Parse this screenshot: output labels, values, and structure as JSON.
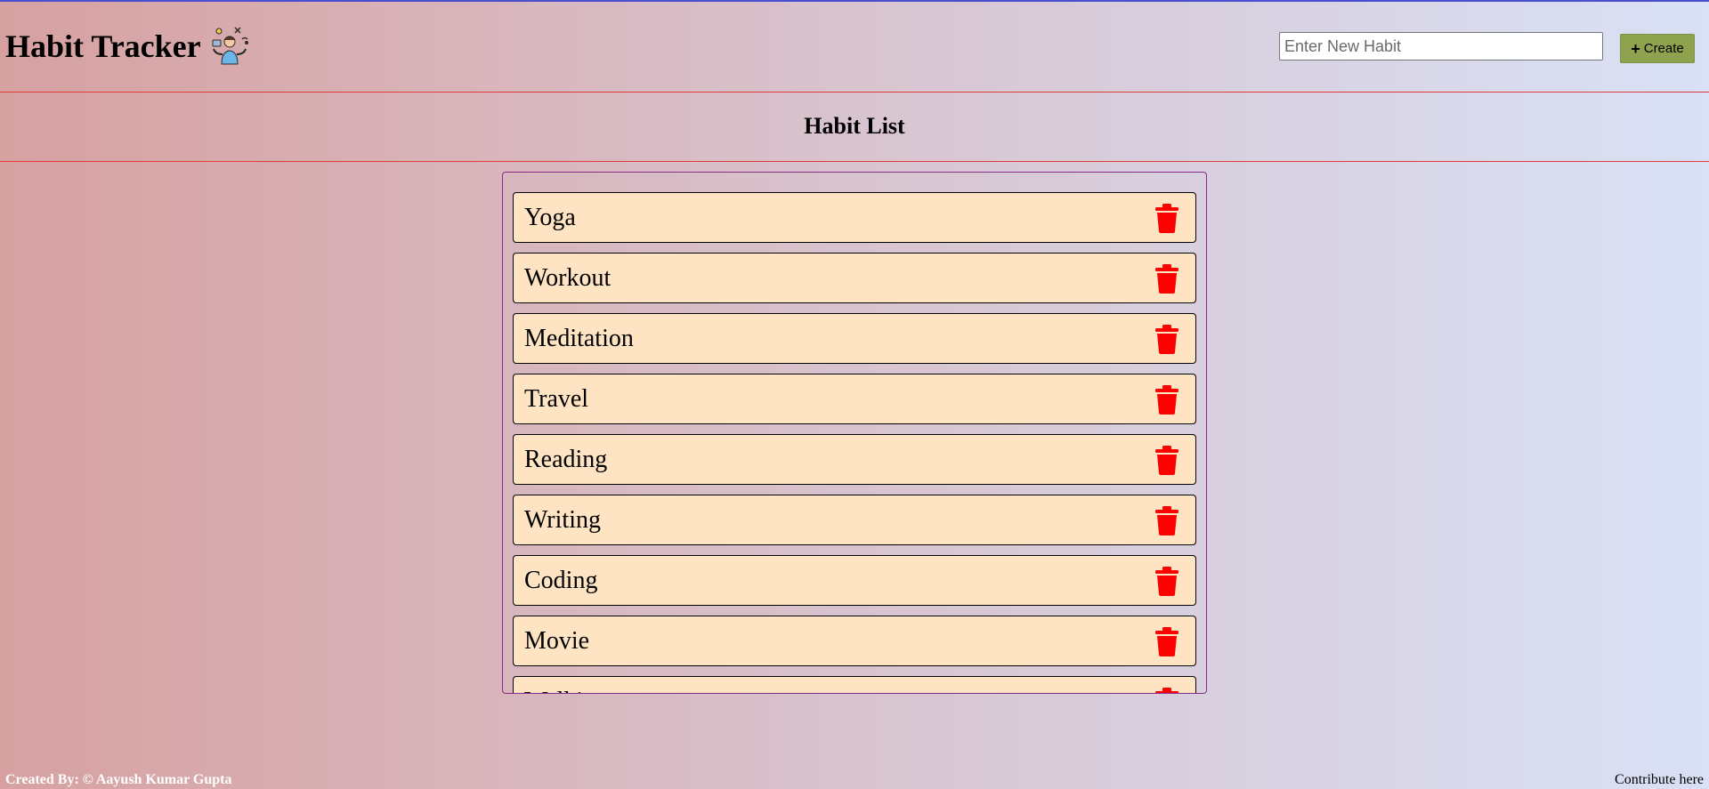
{
  "header": {
    "title": "Habit Tracker",
    "logo_icon": "person-juggling-icon",
    "input_placeholder": "Enter New Habit",
    "input_value": "",
    "create_label": "Create",
    "create_icon": "plus-icon",
    "create_color": "#8fa34f"
  },
  "list": {
    "title": "Habit List",
    "items": [
      {
        "name": "Yoga"
      },
      {
        "name": "Workout"
      },
      {
        "name": "Meditation"
      },
      {
        "name": "Travel"
      },
      {
        "name": "Reading"
      },
      {
        "name": "Writing"
      },
      {
        "name": "Coding"
      },
      {
        "name": "Movie"
      },
      {
        "name": "Walking"
      }
    ],
    "item_background": "#ffe4c4",
    "delete_icon": "trash-icon",
    "delete_color": "#ff0000"
  },
  "footer": {
    "credit": "Created By: © Aayush Kumar Gupta",
    "contribute": "Contribute here"
  },
  "colors": {
    "divider": "#e03b3b",
    "container_border": "#8a2a8a",
    "top_border": "#4a4fd0"
  }
}
